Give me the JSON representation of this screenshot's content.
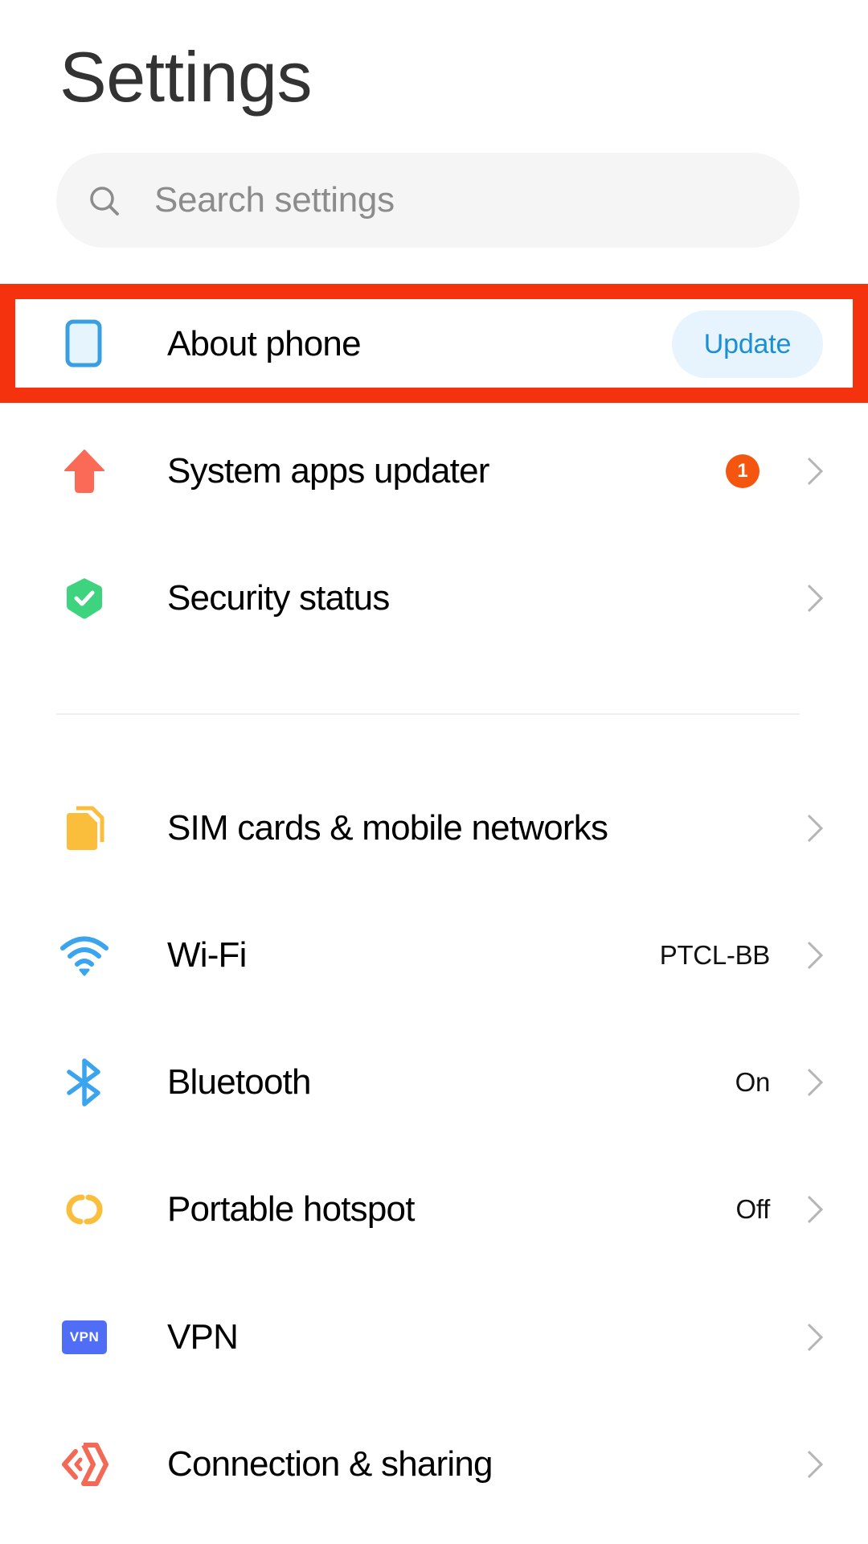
{
  "header": {
    "title": "Settings"
  },
  "search": {
    "placeholder": "Search settings"
  },
  "colors": {
    "highlight": "#f5320e",
    "accent_blue": "#1a8fd4",
    "badge_orange": "#f5560f"
  },
  "sections": [
    {
      "items": [
        {
          "id": "about-phone",
          "label": "About phone",
          "icon": "phone-icon",
          "action_label": "Update",
          "highlighted": true
        },
        {
          "id": "system-apps-updater",
          "label": "System apps updater",
          "icon": "upload-arrow-icon",
          "badge": "1"
        },
        {
          "id": "security-status",
          "label": "Security status",
          "icon": "shield-check-icon"
        }
      ]
    },
    {
      "items": [
        {
          "id": "sim-cards",
          "label": "SIM cards & mobile networks",
          "icon": "sim-card-icon"
        },
        {
          "id": "wifi",
          "label": "Wi-Fi",
          "icon": "wifi-icon",
          "value": "PTCL-BB"
        },
        {
          "id": "bluetooth",
          "label": "Bluetooth",
          "icon": "bluetooth-icon",
          "value": "On"
        },
        {
          "id": "portable-hotspot",
          "label": "Portable hotspot",
          "icon": "hotspot-icon",
          "value": "Off"
        },
        {
          "id": "vpn",
          "label": "VPN",
          "icon": "vpn-icon",
          "icon_text": "VPN"
        },
        {
          "id": "connection-sharing",
          "label": "Connection & sharing",
          "icon": "connection-sharing-icon"
        }
      ]
    }
  ]
}
